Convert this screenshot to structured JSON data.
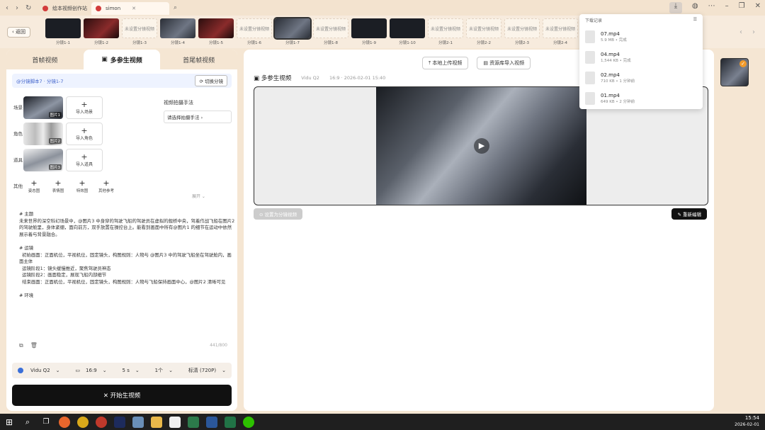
{
  "browser": {
    "tabs": [
      {
        "label": "绘本视频创作站",
        "active": false
      },
      {
        "label": "simon",
        "active": true
      }
    ]
  },
  "strip": {
    "back_label": "返回",
    "shots": [
      {
        "label": "分镜1-1",
        "kind": "dark"
      },
      {
        "label": "分镜1-2",
        "kind": "red"
      },
      {
        "label": "分镜1-3",
        "kind": "empty"
      },
      {
        "label": "分镜1-4",
        "kind": "ship"
      },
      {
        "label": "分镜1-5",
        "kind": "red"
      },
      {
        "label": "分镜1-6",
        "kind": "empty"
      },
      {
        "label": "分镜1-7",
        "kind": "ship",
        "selected": true
      },
      {
        "label": "分镜1-8",
        "kind": "empty"
      },
      {
        "label": "分镜1-9",
        "kind": "dark"
      },
      {
        "label": "分镜1-10",
        "kind": "dark"
      },
      {
        "label": "分镜2-1",
        "kind": "empty"
      },
      {
        "label": "分镜2-2",
        "kind": "empty"
      },
      {
        "label": "分镜2-3",
        "kind": "empty"
      },
      {
        "label": "分镜2-4",
        "kind": "empty"
      }
    ],
    "empty_text": "未设置分镜视频"
  },
  "left": {
    "tabs": [
      "首帧视频",
      "多参生视频",
      "首尾帧视频"
    ],
    "active_tab": 1,
    "shot_info": "@分镜脚本7 · 分镜1-7",
    "shot_button": "切换分镜",
    "assets": [
      {
        "cat": "场景",
        "tag": "图片1",
        "kind": "ship",
        "add": "导入场景"
      },
      {
        "cat": "角色",
        "tag": "图片2",
        "kind": "char",
        "add": "导入角色"
      },
      {
        "cat": "道具",
        "tag": "图片3",
        "kind": "light",
        "add": "导入道具"
      }
    ],
    "others_cat": "其他",
    "others": [
      "姿态图",
      "表情图",
      "特效图",
      "其他参考"
    ],
    "tech_title": "视频拍摄手法",
    "tech_select": "请选择拍摄手法 ›",
    "expand": "展开 ⌄",
    "prompt": "# 主题\n未来世界的深空科幻场景中，@图片3 中身穿的驾驶飞船的驾驶员在虚拟的舰桥中央，驾着作战飞船在图片2 的驾驶舱里，身体紧绷，面向前方，双手放置在操控台上。能看到画面中所有@图片1 的细节在运动中依然展示着与背景融合。\n\n# 运镜\n  初始画面：正面机位，平视机位，固定镜头，构图规则：人物与 @图片3 中的驾驶飞船坐在驾驶舱内，画面主体\n  运镜阶段1：镜头缓慢推近，聚焦驾驶员神态\n  运镜阶段2：画面稳定，展现飞船内部细节\n  结束画面：正面机位，平视机位，固定镜头，构图规则：人物与飞船保持画面中心，@图片2 清晰可见\n\n# 环境",
    "count": "441/800",
    "params": {
      "model": "Vidu Q2",
      "ratio": "16:9",
      "duration": "5 s",
      "count": "1个",
      "quality": "标清 (720P)"
    },
    "generate_label": "✕ 开始生视频"
  },
  "main": {
    "btn_left": "本地上传视频",
    "btn_right": "资源库导入视频",
    "title": "多参生视频",
    "model": "Vidu Q2",
    "meta": "16:9 · 2026-02-01 15:40",
    "set_shot": "设置为分镜视频",
    "regen": "重新编辑"
  },
  "downloads": {
    "title": "下载记录",
    "items": [
      {
        "name": "07.mp4",
        "size": "5.9 MB • 完成"
      },
      {
        "name": "04.mp4",
        "size": "1,544 KB • 完成"
      },
      {
        "name": "02.mp4",
        "size": "710 KB • 1 分钟前"
      },
      {
        "name": "01.mp4",
        "size": "649 KB • 2 分钟前"
      }
    ]
  },
  "taskbar": {
    "time": "15:54",
    "date": "2026-02-01"
  },
  "colors": {
    "accent": "#111111",
    "bg": "#f5e6d3",
    "badge": "#f19a2a"
  }
}
